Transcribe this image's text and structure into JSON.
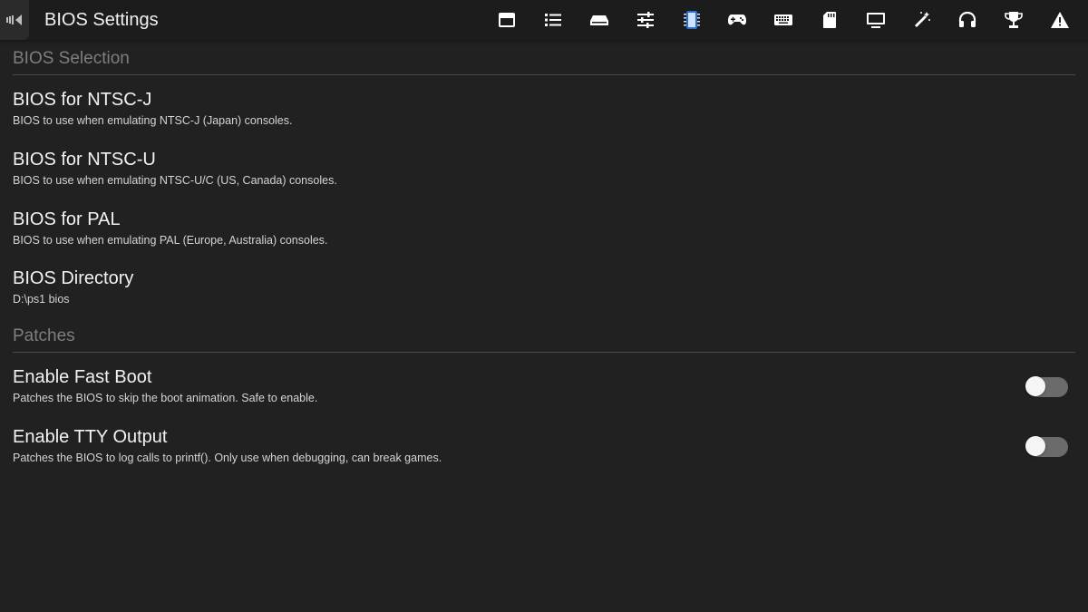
{
  "window": {
    "title": "BIOS Settings"
  },
  "toolbar": {
    "tabs": [
      {
        "icon": "window-icon",
        "name": "Summary"
      },
      {
        "icon": "list-icon",
        "name": "Game List"
      },
      {
        "icon": "console-icon",
        "name": "Console"
      },
      {
        "icon": "sliders-icon",
        "name": "Emulation"
      },
      {
        "icon": "chip-icon",
        "name": "BIOS",
        "active": true
      },
      {
        "icon": "gamepad-icon",
        "name": "Controllers"
      },
      {
        "icon": "keyboard-icon",
        "name": "Hotkeys"
      },
      {
        "icon": "memory-card-icon",
        "name": "Memory Cards"
      },
      {
        "icon": "display-icon",
        "name": "Display"
      },
      {
        "icon": "magic-wand-icon",
        "name": "Post-Processing"
      },
      {
        "icon": "headphones-icon",
        "name": "Audio"
      },
      {
        "icon": "trophy-icon",
        "name": "Achievements"
      },
      {
        "icon": "warning-icon",
        "name": "Advanced"
      }
    ]
  },
  "sections": {
    "bios_selection": {
      "header": "BIOS Selection"
    },
    "patches": {
      "header": "Patches"
    }
  },
  "settings": {
    "ntsc_j": {
      "title": "BIOS for NTSC-J",
      "description": "BIOS to use when emulating NTSC-J (Japan) consoles."
    },
    "ntsc_u": {
      "title": "BIOS for NTSC-U",
      "description": "BIOS to use when emulating NTSC-U/C (US, Canada) consoles."
    },
    "pal": {
      "title": "BIOS for PAL",
      "description": "BIOS to use when emulating PAL (Europe, Australia) consoles."
    },
    "bios_directory": {
      "title": "BIOS Directory",
      "value": "D:\\ps1 bios"
    },
    "fast_boot": {
      "title": "Enable Fast Boot",
      "description": "Patches the BIOS to skip the boot animation. Safe to enable.",
      "enabled": false
    },
    "tty_output": {
      "title": "Enable TTY Output",
      "description": "Patches the BIOS to log calls to printf(). Only use when debugging, can break games.",
      "enabled": false
    }
  },
  "colors": {
    "background": "#212121",
    "topbar": "#1c1c1c",
    "section_header": "#7e7e7e",
    "toggle_track_off": "#6b6b6b",
    "toggle_thumb": "#f5f5f5"
  }
}
